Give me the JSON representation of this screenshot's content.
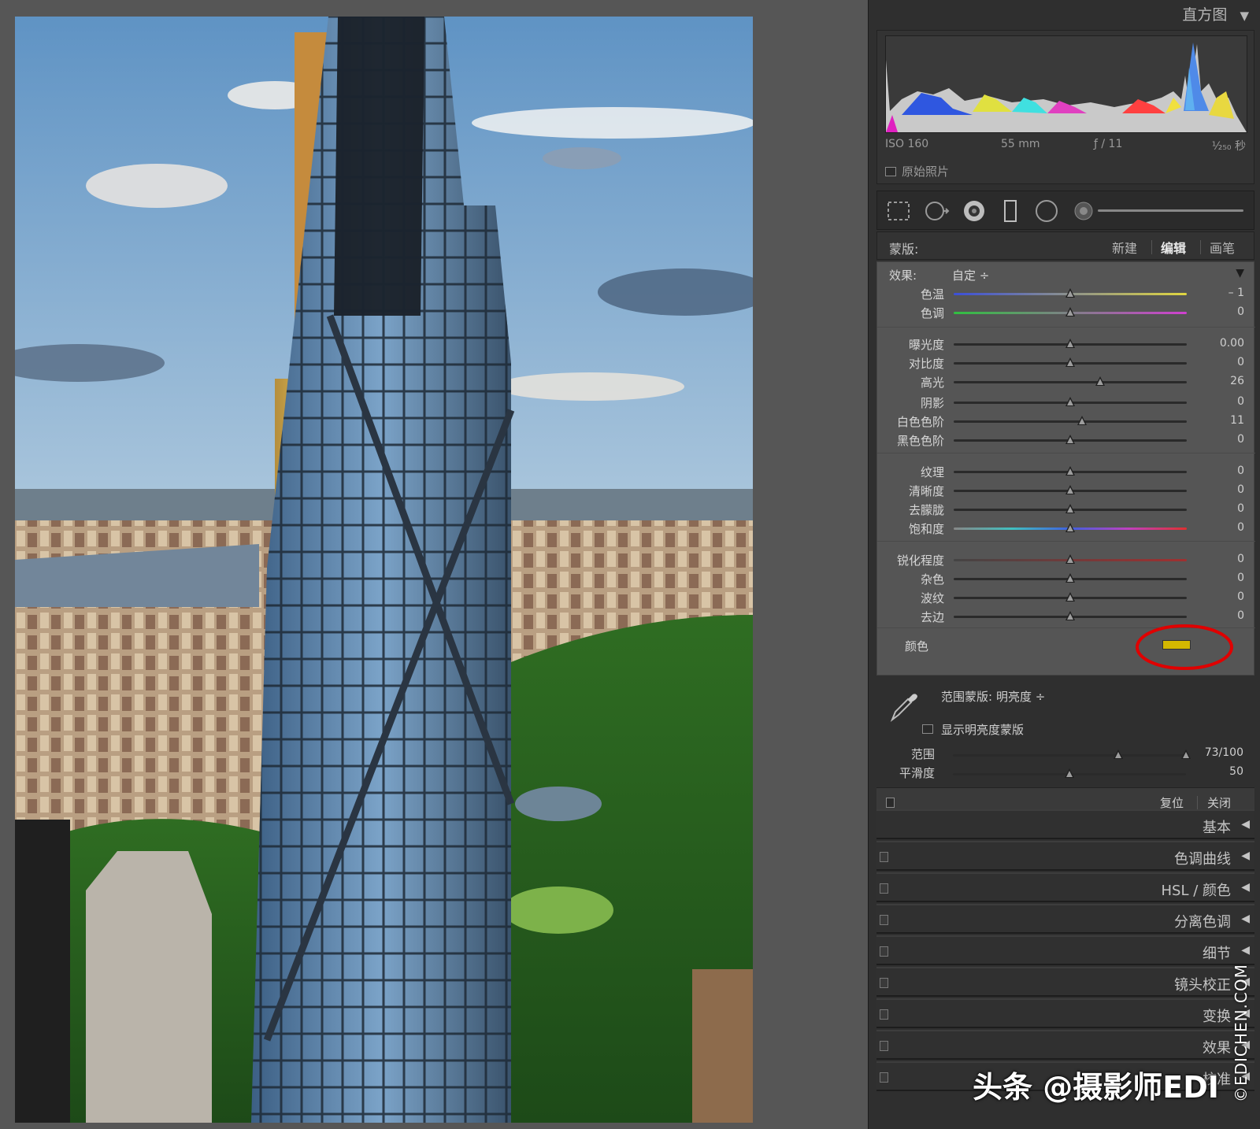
{
  "histogram": {
    "title": "直方图",
    "iso": "ISO 160",
    "focal": "55 mm",
    "aperture": "ƒ / 11",
    "shutter": "¹⁄₂₅₀ 秒",
    "original_photo": "原始照片"
  },
  "tools": [
    "crop-tool",
    "spot-removal-tool",
    "red-eye-tool",
    "graduated-filter-tool",
    "radial-filter-tool",
    "adjustment-brush-tool"
  ],
  "mask": {
    "label": "蒙版:",
    "new": "新建",
    "edit": "编辑",
    "brush": "画笔"
  },
  "effect": {
    "label": "效果:",
    "preset": "自定 ÷"
  },
  "sliders": [
    {
      "label": "色温",
      "value": "– 1",
      "pos": 0.5
    },
    {
      "label": "色调",
      "value": "0",
      "pos": 0.5
    },
    {
      "label": "曝光度",
      "value": "0.00",
      "pos": 0.5
    },
    {
      "label": "对比度",
      "value": "0",
      "pos": 0.5
    },
    {
      "label": "高光",
      "value": "26",
      "pos": 0.63
    },
    {
      "label": "阴影",
      "value": "0",
      "pos": 0.5
    },
    {
      "label": "白色色阶",
      "value": "11",
      "pos": 0.55
    },
    {
      "label": "黑色色阶",
      "value": "0",
      "pos": 0.5
    },
    {
      "label": "纹理",
      "value": "0",
      "pos": 0.5
    },
    {
      "label": "清晰度",
      "value": "0",
      "pos": 0.5
    },
    {
      "label": "去朦胧",
      "value": "0",
      "pos": 0.5
    },
    {
      "label": "饱和度",
      "value": "0",
      "pos": 0.5
    },
    {
      "label": "锐化程度",
      "value": "0",
      "pos": 0.5
    },
    {
      "label": "杂色",
      "value": "0",
      "pos": 0.5
    },
    {
      "label": "波纹",
      "value": "0",
      "pos": 0.5
    },
    {
      "label": "去边",
      "value": "0",
      "pos": 0.5
    }
  ],
  "color": {
    "label": "颜色",
    "swatch": "#d4b800",
    "highlight": "#e00000"
  },
  "range_mask": {
    "label": "范围蒙版:",
    "type": "明亮度 ÷",
    "show_mask": "显示明亮度蒙版",
    "range_label": "范围",
    "range_value": "73/100",
    "range_low": 0.71,
    "range_high": 1.0,
    "smooth_label": "平滑度",
    "smooth_value": "50",
    "smooth_pos": 0.5,
    "reset": "复位",
    "close": "关闭"
  },
  "panels": [
    "基本",
    "色调曲线",
    "HSL / 颜色",
    "分离色调",
    "细节",
    "镜头校正",
    "变换",
    "效果",
    "校准"
  ],
  "watermarks": {
    "vertical": "©EDICHEN.COM",
    "bottom": "头条 @摄影师EDI"
  }
}
